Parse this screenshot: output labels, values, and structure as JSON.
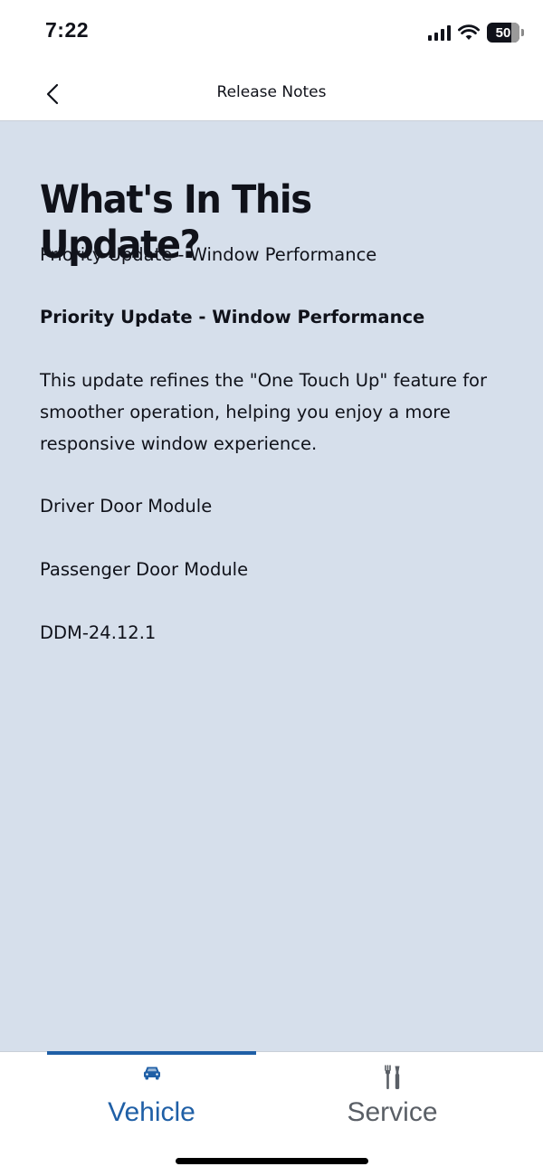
{
  "status_bar": {
    "time": "7:22",
    "battery": "50"
  },
  "header": {
    "title": "Release Notes",
    "back_icon": "chevron-left-icon"
  },
  "content": {
    "title": "What's In This Update?",
    "subtitle": "Priority Update - Window Performance",
    "bold_heading": "Priority Update - Window Performance",
    "description": "This update refines the \"One Touch Up\" feature for smoother operation, helping you enjoy a more responsive window experience.",
    "modules": [
      "Driver Door Module",
      "Passenger Door Module"
    ],
    "version": "DDM-24.12.1"
  },
  "tabs": [
    {
      "label": "Vehicle",
      "icon": "car-icon",
      "active": true
    },
    {
      "label": "Service",
      "icon": "tools-icon",
      "active": false
    }
  ],
  "colors": {
    "accent": "#1f5fa6",
    "content_background": "#d6dfeb",
    "text": "#10121a",
    "inactive_tab": "#5a5f66"
  }
}
